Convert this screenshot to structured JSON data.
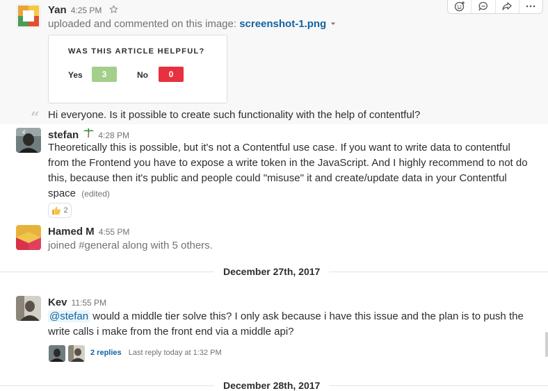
{
  "messages": {
    "yan": {
      "sender": "Yan",
      "time": "4:25 PM",
      "action": "uploaded and commented on this image:",
      "file": "screenshot-1.png",
      "comment": "Hi everyone. Is it possible to create such functionality with the help of contentful?",
      "card": {
        "title": "WAS THIS ARTICLE HELPFUL?",
        "yes_label": "Yes",
        "yes_count": "3",
        "no_label": "No",
        "no_count": "0"
      }
    },
    "stefan": {
      "sender": "stefan",
      "time": "4:28 PM",
      "status_emoji": "palm-tree-icon",
      "text": "Theoretically this is possible, but it's not a Contentful use case. If you want to write data to contentful from the Frontend you have to expose a write token in the JavaScript. And I highly recommend to not do this, because then it's public and people could \"misuse\" it and create/update data in your Contentful space",
      "edited": "(edited)",
      "reaction_count": "2"
    },
    "hamed": {
      "sender": "Hamed M",
      "time": "4:55 PM",
      "text": "joined #general along with 5 others."
    },
    "kev": {
      "sender": "Kev",
      "time": "11:55 PM",
      "mention": "@stefan",
      "text": "would a middle tier solve this? I only ask because i have this issue and the plan is to push the write calls i make from the front end via a middle api?",
      "replies": "2 replies",
      "last_reply": "Last reply today at 1:32 PM"
    }
  },
  "dividers": {
    "dec27": "December 27th, 2017",
    "dec28": "December 28th, 2017"
  },
  "actions": [
    "add-reaction-icon",
    "comment-icon",
    "share-icon",
    "more-icon"
  ],
  "colors": {
    "link": "#1264a3",
    "yes_pill": "#a3cf8b",
    "no_pill": "#e8313f"
  }
}
